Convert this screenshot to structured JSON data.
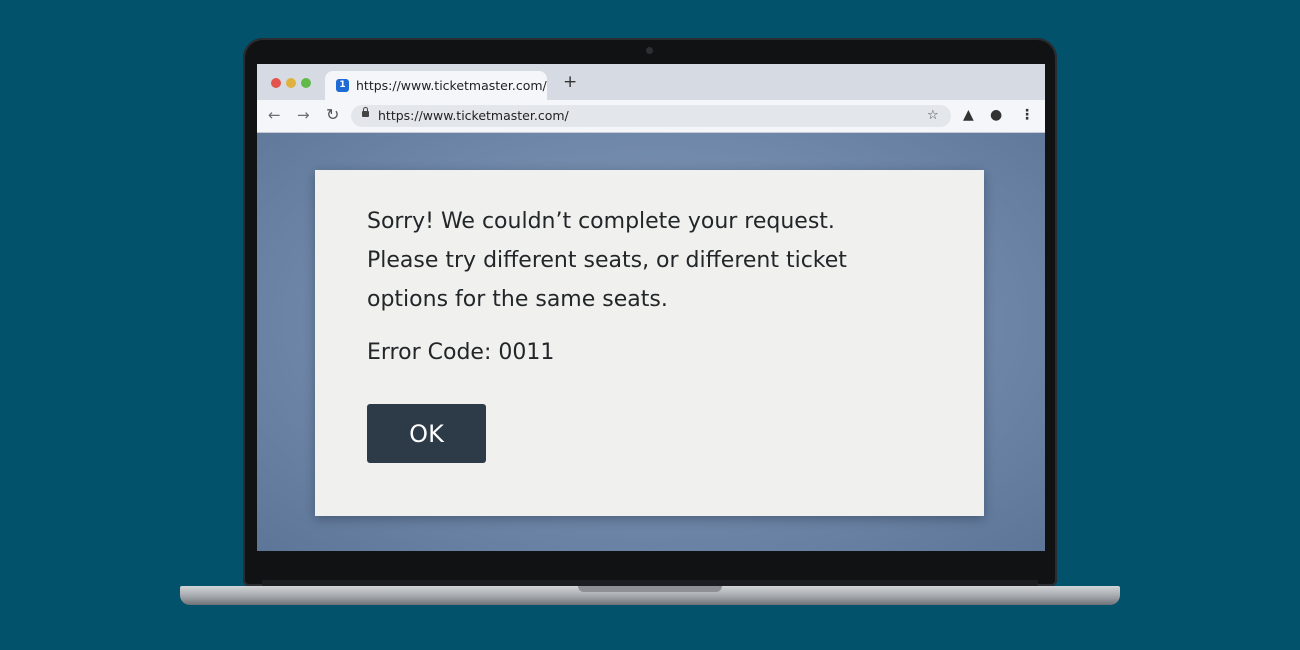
{
  "browser": {
    "tab": {
      "title": "https://www.ticketmaster.com/",
      "favicon": "1"
    },
    "new_tab_label": "+",
    "address_bar": {
      "url": "https://www.ticketmaster.com/"
    },
    "nav": {
      "back_icon": "arrow-left-icon",
      "forward_icon": "arrow-right-icon",
      "reload_icon": "reload-icon"
    }
  },
  "dialog": {
    "message_lines": [
      "Sorry! We couldn’t complete your request.",
      "Please try different seats, or different ticket",
      "options for the same seats."
    ],
    "error_code": "Error Code: 0011",
    "ok_label": "OK"
  },
  "colors": {
    "background": "#03526b",
    "page": "#6f88aa",
    "dialog": "#f0f0ef",
    "button": "#2d3b48"
  }
}
